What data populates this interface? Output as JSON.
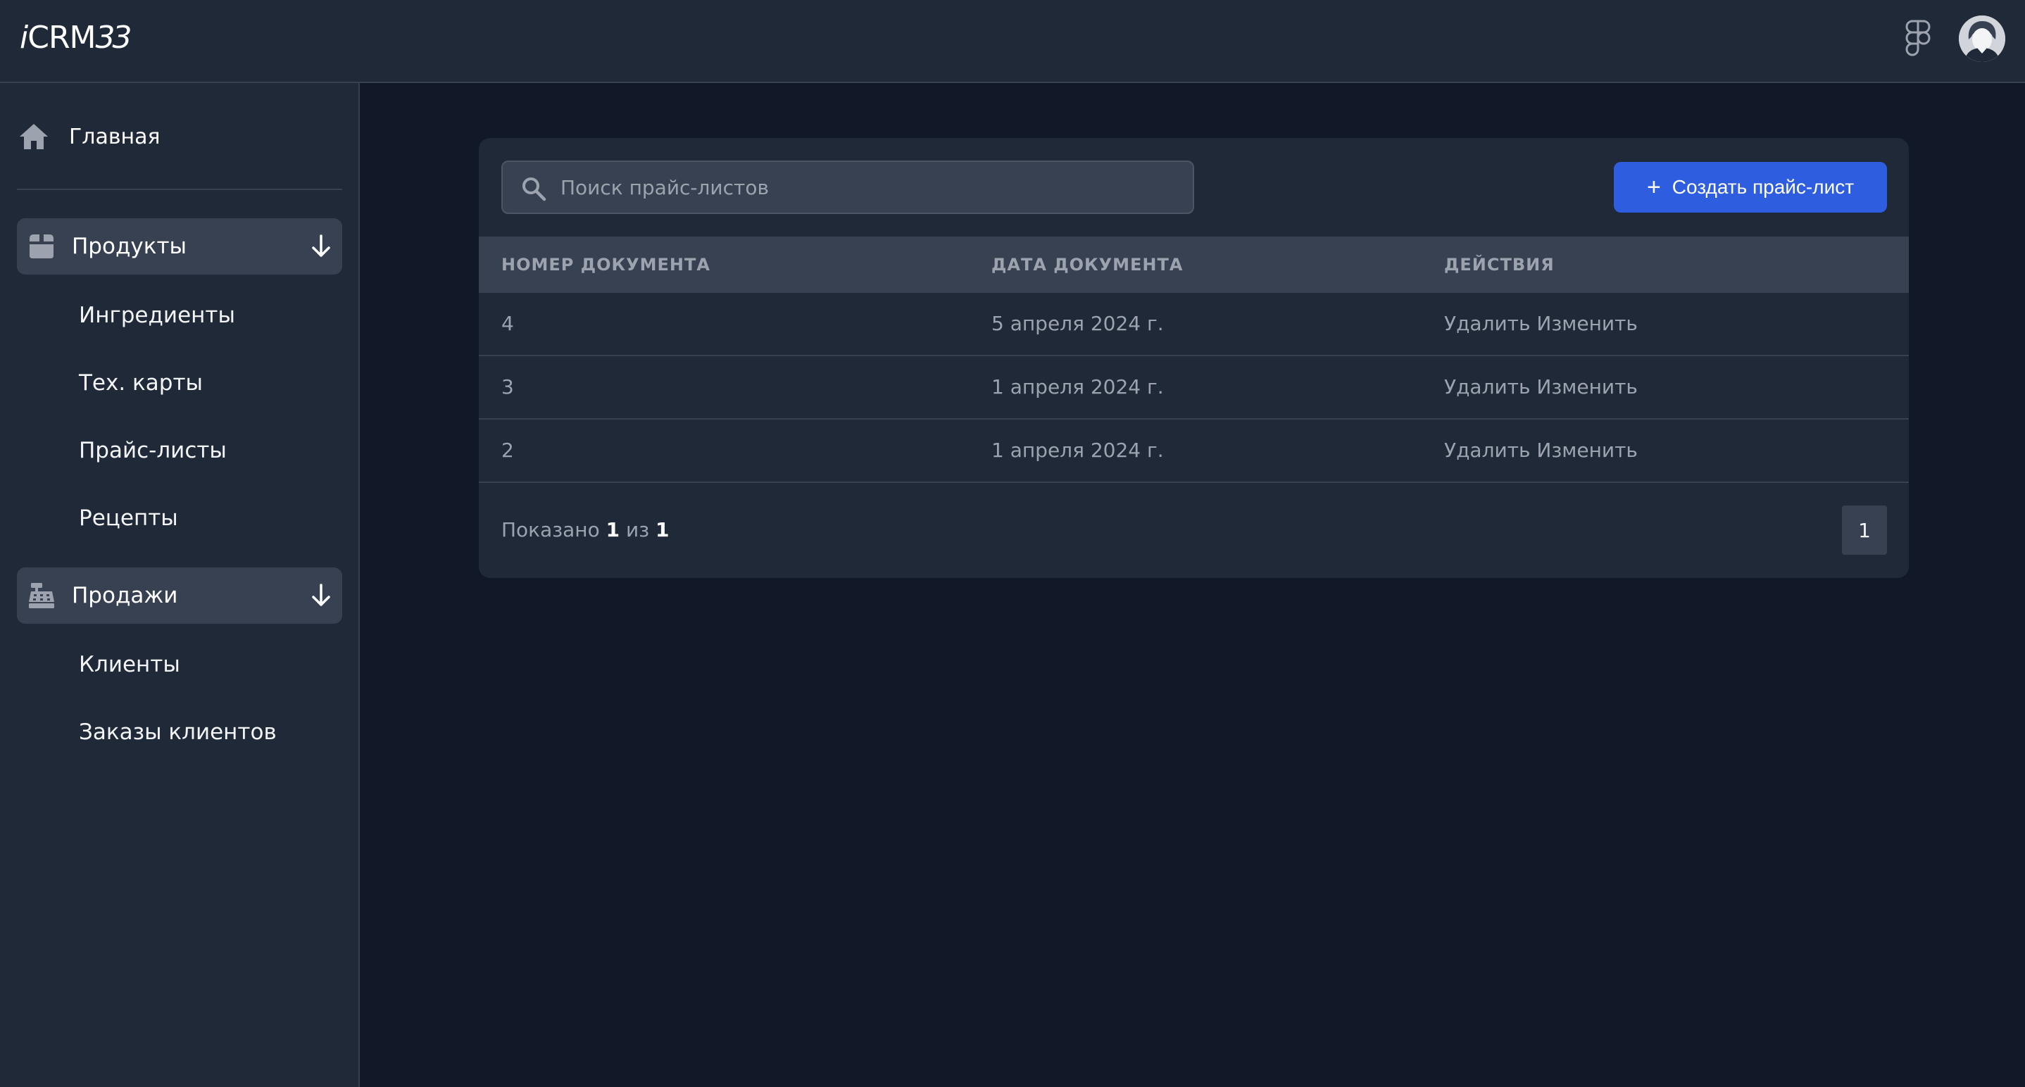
{
  "header": {
    "logo_prefix": "i",
    "logo_main": "CRM",
    "logo_suffix": "33",
    "icons": [
      "figma-icon",
      "user-avatar-icon"
    ]
  },
  "sidebar": {
    "home": {
      "label": "Главная",
      "icon": "home-icon"
    },
    "groups": [
      {
        "label": "Продукты",
        "icon": "box-icon",
        "items": [
          "Ингредиенты",
          "Тех. карты",
          "Прайс-листы",
          "Рецепты"
        ]
      },
      {
        "label": "Продажи",
        "icon": "cash-register-icon",
        "items": [
          "Клиенты",
          "Заказы клиентов"
        ]
      }
    ]
  },
  "main": {
    "search": {
      "placeholder": "Поиск прайс-листов",
      "value": ""
    },
    "create_button": {
      "plus": "+",
      "label": "Создать прайс-лист"
    },
    "table": {
      "columns": [
        "НОМЕР ДОКУМЕНТА",
        "ДАТА ДОКУМЕНТА",
        "ДЕЙСТВИЯ"
      ],
      "rows": [
        {
          "number": "4",
          "date": "5 апреля 2024 г.",
          "delete": "Удалить",
          "edit": "Изменить"
        },
        {
          "number": "3",
          "date": "1 апреля 2024 г.",
          "delete": "Удалить",
          "edit": "Изменить"
        },
        {
          "number": "2",
          "date": "1 апреля 2024 г.",
          "delete": "Удалить",
          "edit": "Изменить"
        }
      ]
    },
    "pagination": {
      "shown_prefix": "Показано",
      "current": "1",
      "of": "из",
      "total": "1",
      "page_button": "1"
    }
  },
  "colors": {
    "background": "#111827",
    "panel": "#1f2937",
    "muted": "#374151",
    "accent": "#2f5de0",
    "text_muted": "#9ca3af"
  }
}
